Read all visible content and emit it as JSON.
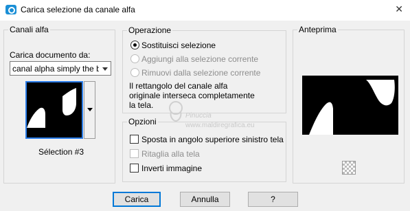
{
  "window": {
    "title": "Carica selezione da canale alfa",
    "close_glyph": "✕"
  },
  "channels": {
    "group_label": "Canali alfa",
    "load_from_label": "Carica documento da:",
    "source_select_value": "canal alpha simply the be",
    "selection_caption": "Sélection #3"
  },
  "operation": {
    "group_label": "Operazione",
    "options": [
      {
        "label": "Sostituisci selezione",
        "checked": true,
        "enabled": true
      },
      {
        "label": "Aggiungi alla selezione corrente",
        "checked": false,
        "enabled": false
      },
      {
        "label": "Rimuovi dalla selezione corrente",
        "checked": false,
        "enabled": false
      }
    ],
    "info_text_lines": [
      "Il rettangolo del canale alfa",
      "originale interseca completamente",
      "la tela."
    ]
  },
  "options": {
    "group_label": "Opzioni",
    "checkboxes": [
      {
        "label": "Sposta in angolo superiore sinistro tela",
        "checked": false,
        "enabled": true
      },
      {
        "label": "Ritaglia alla tela",
        "checked": false,
        "enabled": false
      },
      {
        "label": "Inverti immagine",
        "checked": false,
        "enabled": true
      }
    ]
  },
  "preview": {
    "group_label": "Anteprima",
    "icons": {
      "toggle": "transparency-checker-icon"
    }
  },
  "watermark": {
    "name": "Pinuccia",
    "url": "www.maldiregrafica.eu"
  },
  "buttons": {
    "load": "Carica",
    "cancel": "Annulla",
    "help": "?"
  },
  "colors": {
    "accent": "#0078d7",
    "dialog_bg": "#f0f0f0"
  }
}
